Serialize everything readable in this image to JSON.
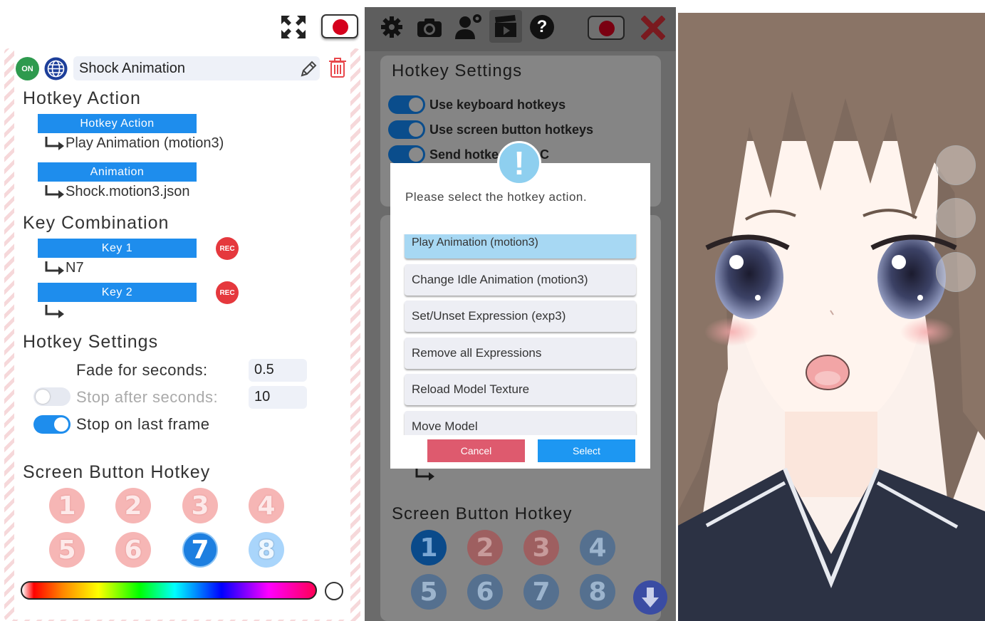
{
  "left": {
    "status_badge": "ON",
    "animation_name": "Shock Animation",
    "hotkey_action": {
      "title": "Hotkey Action",
      "action_label": "Hotkey Action",
      "action_value": "Play Animation (motion3)",
      "animation_label": "Animation",
      "animation_value": "Shock.motion3.json"
    },
    "key_combination": {
      "title": "Key Combination",
      "key1_label": "Key 1",
      "key1_value": "N7",
      "key2_label": "Key 2",
      "key2_value": "",
      "rec_label": "REC"
    },
    "hotkey_settings": {
      "title": "Hotkey Settings",
      "fade_label": "Fade for seconds:",
      "fade_value": "0.5",
      "stop_after_label": "Stop after seconds:",
      "stop_after_value": "10",
      "stop_after_enabled": false,
      "stop_last_label": "Stop on last frame",
      "stop_last_enabled": true
    },
    "screen_button": {
      "title": "Screen Button Hotkey",
      "buttons": [
        "1",
        "2",
        "3",
        "4",
        "5",
        "6",
        "7",
        "8"
      ],
      "selected": "7"
    },
    "colors": {
      "accent": "#1e8ded",
      "rec": "#e5383d",
      "on": "#2e9a4e"
    }
  },
  "mid": {
    "panel_title": "Hotkey Settings",
    "toggles": [
      "Use keyboard hotkeys",
      "Use screen button hotkeys",
      "Send hotke"
    ],
    "toggle_suffix": "C",
    "dialog": {
      "message": "Please select the hotkey action.",
      "options": [
        "Play Animation (motion3)",
        "Change Idle Animation (motion3)",
        "Set/Unset Expression (exp3)",
        "Remove all Expressions",
        "Reload Model Texture",
        "Move Model"
      ],
      "cancel": "Cancel",
      "select": "Select"
    },
    "screen_button": {
      "title": "Screen Button Hotkey",
      "buttons": [
        "1",
        "2",
        "3",
        "4",
        "5",
        "6",
        "7",
        "8"
      ]
    }
  }
}
